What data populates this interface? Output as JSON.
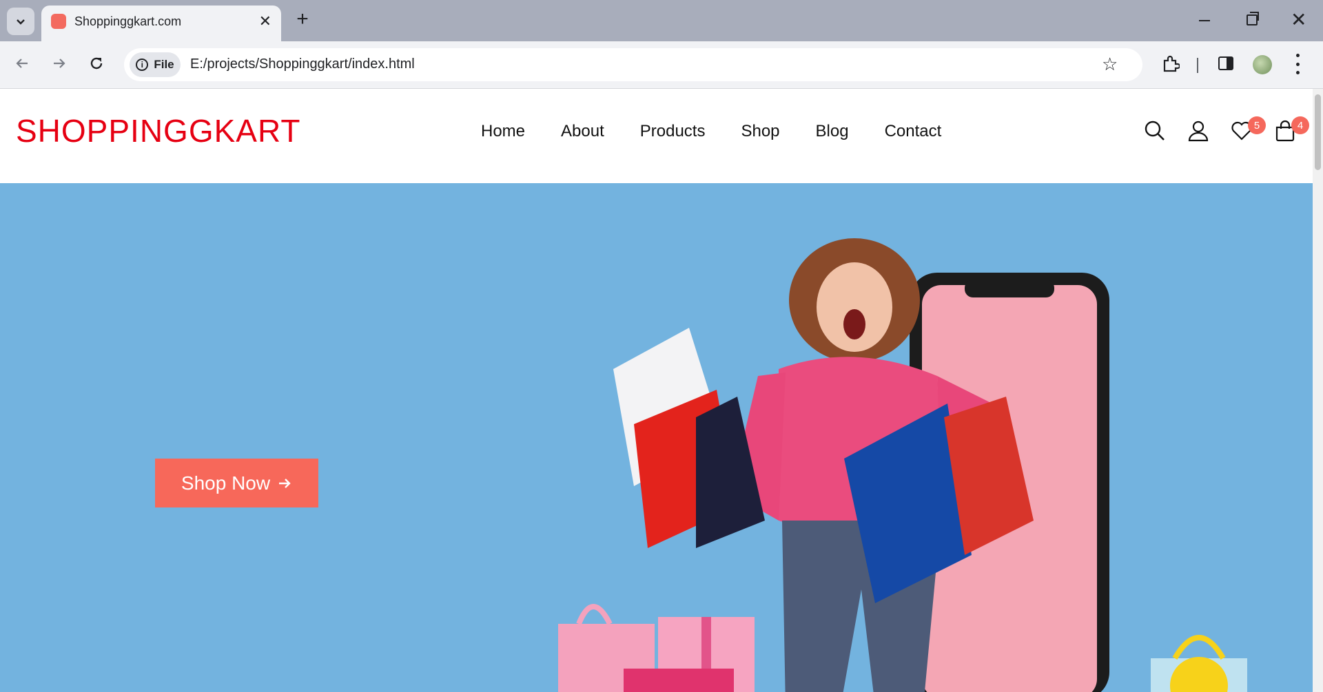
{
  "browser": {
    "tab_title": "Shoppinggkart.com",
    "file_label": "File",
    "url": "E:/projects/Shoppinggkart/index.html"
  },
  "site": {
    "logo": "SHOPPINGGKART",
    "nav": [
      "Home",
      "About",
      "Products",
      "Shop",
      "Blog",
      "Contact"
    ],
    "wishlist_count": "5",
    "cart_count": "4",
    "accent_color": "#e60012",
    "badge_color": "#f5685c"
  },
  "hero": {
    "background_color": "#73b3df",
    "cta_label": "Shop Now",
    "cta_color": "#f7685a"
  },
  "icons": {
    "search": "search-icon",
    "account": "user-icon",
    "wishlist": "heart-icon",
    "cart": "shopping-bag-icon"
  }
}
